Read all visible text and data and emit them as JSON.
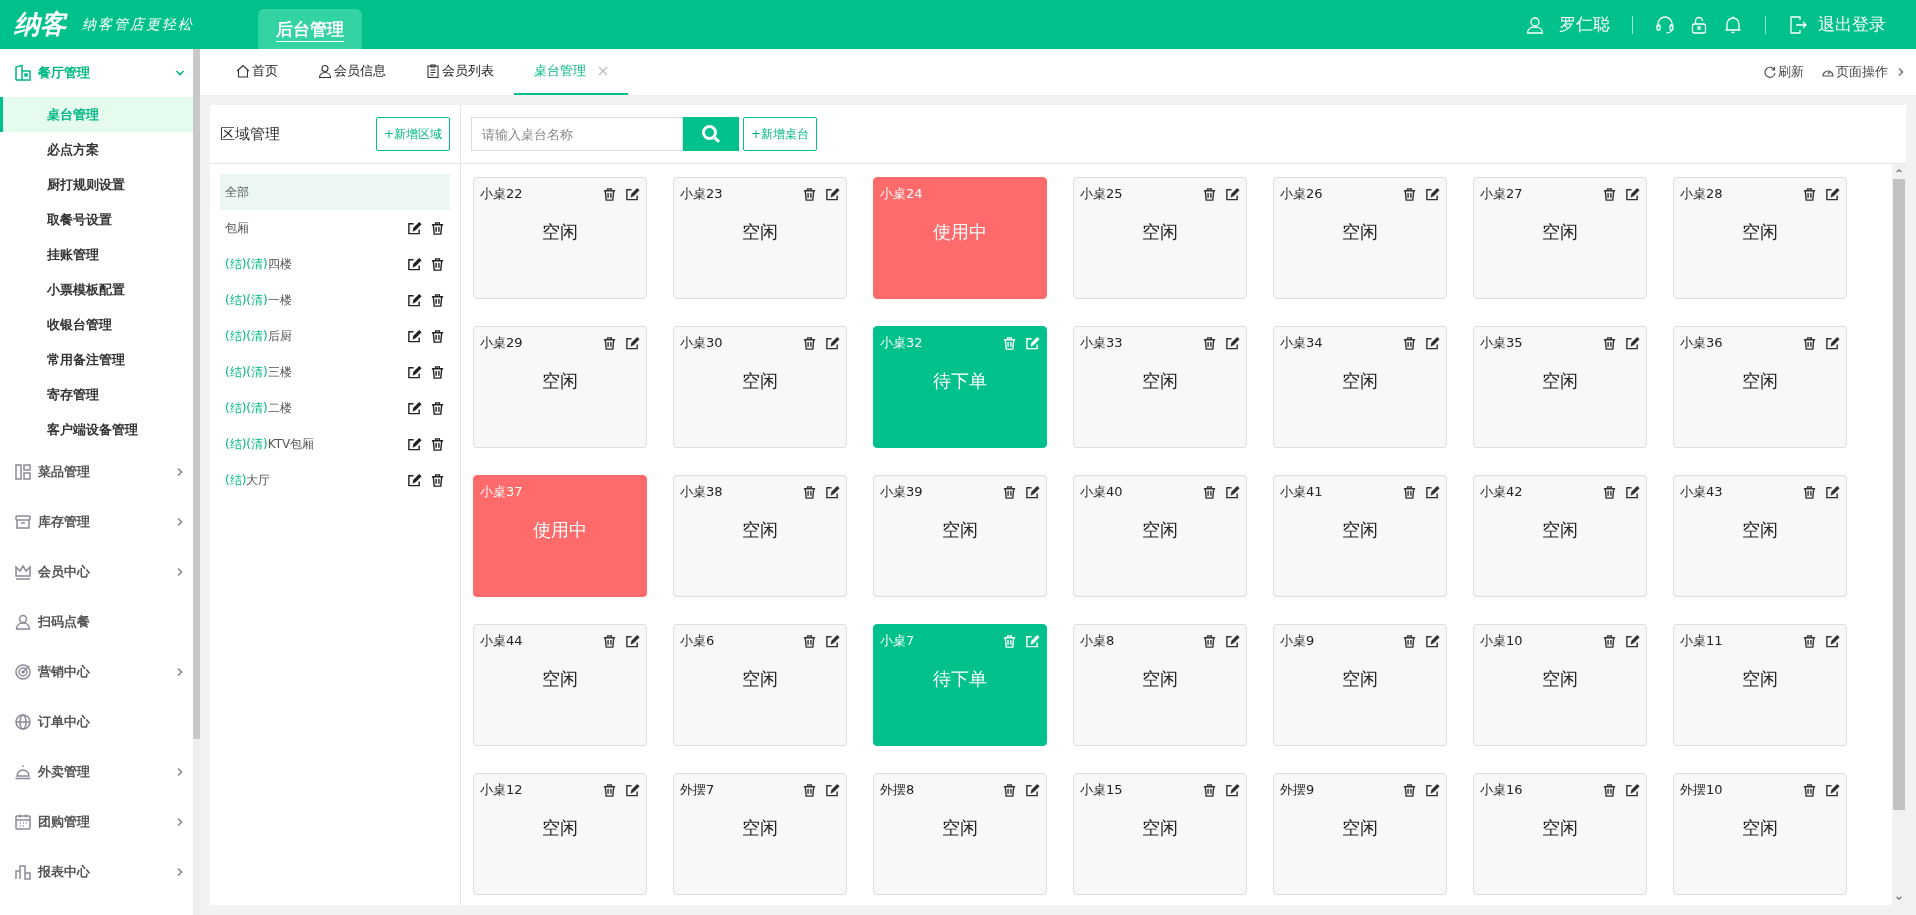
{
  "header": {
    "logo": "纳客",
    "slogan": "纳客管店更轻松",
    "nav_tab": {
      "label": "后台管理",
      "selected": true
    },
    "user": "罗仁聪",
    "logout": "退出登录"
  },
  "sidebar": {
    "groups": [
      {
        "label": "餐厅管理",
        "expanded": true,
        "has_submenu": true,
        "children": [
          {
            "label": "桌台管理",
            "selected": true
          },
          {
            "label": "必点方案",
            "selected": false
          },
          {
            "label": "厨打规则设置",
            "selected": false
          },
          {
            "label": "取餐号设置",
            "selected": false
          },
          {
            "label": "挂账管理",
            "selected": false
          },
          {
            "label": "小票模板配置",
            "selected": false
          },
          {
            "label": "收银台管理",
            "selected": false
          },
          {
            "label": "常用备注管理",
            "selected": false
          },
          {
            "label": "寄存管理",
            "selected": false
          },
          {
            "label": "客户端设备管理",
            "selected": false
          }
        ]
      },
      {
        "label": "菜品管理",
        "expanded": false,
        "has_submenu": true
      },
      {
        "label": "库存管理",
        "expanded": false,
        "has_submenu": true
      },
      {
        "label": "会员中心",
        "expanded": false,
        "has_submenu": true
      },
      {
        "label": "扫码点餐",
        "expanded": false,
        "has_submenu": false
      },
      {
        "label": "营销中心",
        "expanded": false,
        "has_submenu": true
      },
      {
        "label": "订单中心",
        "expanded": false,
        "has_submenu": false
      },
      {
        "label": "外卖管理",
        "expanded": false,
        "has_submenu": true
      },
      {
        "label": "团购管理",
        "expanded": false,
        "has_submenu": true
      },
      {
        "label": "报表中心",
        "expanded": false,
        "has_submenu": true
      }
    ]
  },
  "tabs": [
    {
      "label": "首页",
      "selected": false,
      "closable": false
    },
    {
      "label": "会员信息",
      "selected": false,
      "closable": false
    },
    {
      "label": "会员列表",
      "selected": false,
      "closable": false
    },
    {
      "label": "桌台管理",
      "selected": true,
      "closable": true
    }
  ],
  "tab_actions": {
    "refresh": "刷新",
    "page_ops": "页面操作"
  },
  "area_panel": {
    "title": "区域管理",
    "add_button": "+新增区域",
    "areas": [
      {
        "name": "全部",
        "selected": true,
        "editable": false
      },
      {
        "name": "包厢",
        "selected": false,
        "editable": true
      },
      {
        "tags": "(结)(清)",
        "name": "四楼",
        "selected": false,
        "editable": true
      },
      {
        "tags": "(结)(清)",
        "name": "一楼",
        "selected": false,
        "editable": true
      },
      {
        "tags": "(结)(清)",
        "name": "后厨",
        "selected": false,
        "editable": true
      },
      {
        "tags": "(结)(清)",
        "name": "三楼",
        "selected": false,
        "editable": true
      },
      {
        "tags": "(结)(清)",
        "name": "二楼",
        "selected": false,
        "editable": true
      },
      {
        "tags": "(结)(清)",
        "name": "KTV包厢",
        "selected": false,
        "editable": true
      },
      {
        "tags": "(结)",
        "name": "大厅",
        "selected": false,
        "editable": true
      }
    ]
  },
  "table_panel": {
    "search": {
      "placeholder": "请输入桌台名称"
    },
    "add_button": "+新增桌台",
    "tables": [
      {
        "name": "小桌22",
        "status": "空闲",
        "kind": "idle"
      },
      {
        "name": "小桌23",
        "status": "空闲",
        "kind": "idle"
      },
      {
        "name": "小桌24",
        "status": "使用中",
        "kind": "busy"
      },
      {
        "name": "小桌25",
        "status": "空闲",
        "kind": "idle"
      },
      {
        "name": "小桌26",
        "status": "空闲",
        "kind": "idle"
      },
      {
        "name": "小桌27",
        "status": "空闲",
        "kind": "idle"
      },
      {
        "name": "小桌28",
        "status": "空闲",
        "kind": "idle"
      },
      {
        "name": "小桌29",
        "status": "空闲",
        "kind": "idle"
      },
      {
        "name": "小桌30",
        "status": "空闲",
        "kind": "idle"
      },
      {
        "name": "小桌32",
        "status": "待下单",
        "kind": "pending"
      },
      {
        "name": "小桌33",
        "status": "空闲",
        "kind": "idle"
      },
      {
        "name": "小桌34",
        "status": "空闲",
        "kind": "idle"
      },
      {
        "name": "小桌35",
        "status": "空闲",
        "kind": "idle"
      },
      {
        "name": "小桌36",
        "status": "空闲",
        "kind": "idle"
      },
      {
        "name": "小桌37",
        "status": "使用中",
        "kind": "busy"
      },
      {
        "name": "小桌38",
        "status": "空闲",
        "kind": "idle"
      },
      {
        "name": "小桌39",
        "status": "空闲",
        "kind": "idle"
      },
      {
        "name": "小桌40",
        "status": "空闲",
        "kind": "idle"
      },
      {
        "name": "小桌41",
        "status": "空闲",
        "kind": "idle"
      },
      {
        "name": "小桌42",
        "status": "空闲",
        "kind": "idle"
      },
      {
        "name": "小桌43",
        "status": "空闲",
        "kind": "idle"
      },
      {
        "name": "小桌44",
        "status": "空闲",
        "kind": "idle"
      },
      {
        "name": "小桌6",
        "status": "空闲",
        "kind": "idle"
      },
      {
        "name": "小桌7",
        "status": "待下单",
        "kind": "pending"
      },
      {
        "name": "小桌8",
        "status": "空闲",
        "kind": "idle"
      },
      {
        "name": "小桌9",
        "status": "空闲",
        "kind": "idle"
      },
      {
        "name": "小桌10",
        "status": "空闲",
        "kind": "idle"
      },
      {
        "name": "小桌11",
        "status": "空闲",
        "kind": "idle"
      },
      {
        "name": "小桌12",
        "status": "空闲",
        "kind": "idle"
      },
      {
        "name": "外摆7",
        "status": "空闲",
        "kind": "idle"
      },
      {
        "name": "外摆8",
        "status": "空闲",
        "kind": "idle"
      },
      {
        "name": "小桌15",
        "status": "空闲",
        "kind": "idle"
      },
      {
        "name": "外摆9",
        "status": "空闲",
        "kind": "idle"
      },
      {
        "name": "小桌16",
        "status": "空闲",
        "kind": "idle"
      },
      {
        "name": "外摆10",
        "status": "空闲",
        "kind": "idle"
      }
    ]
  }
}
